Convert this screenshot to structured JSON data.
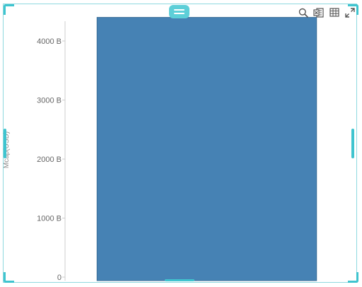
{
  "toolbar": {
    "icons": [
      "search-icon",
      "export-excel-icon",
      "table-view-icon",
      "expand-icon"
    ]
  },
  "colors": {
    "accent": "#3fc4cf",
    "bar": "#4682b4",
    "axis": "#cccccc",
    "tick_text": "#666666"
  },
  "chart_data": {
    "type": "bar",
    "categories": [
      ""
    ],
    "values": [
      4400
    ],
    "ylabel": "Mcap(USD)",
    "ylim": [
      0,
      4500
    ],
    "yticks": [
      0,
      1000,
      2000,
      3000,
      4000
    ],
    "ytick_labels": [
      "0",
      "1000 B",
      "2000 B",
      "3000 B",
      "4000 B"
    ],
    "grid": false,
    "legend": "none"
  }
}
